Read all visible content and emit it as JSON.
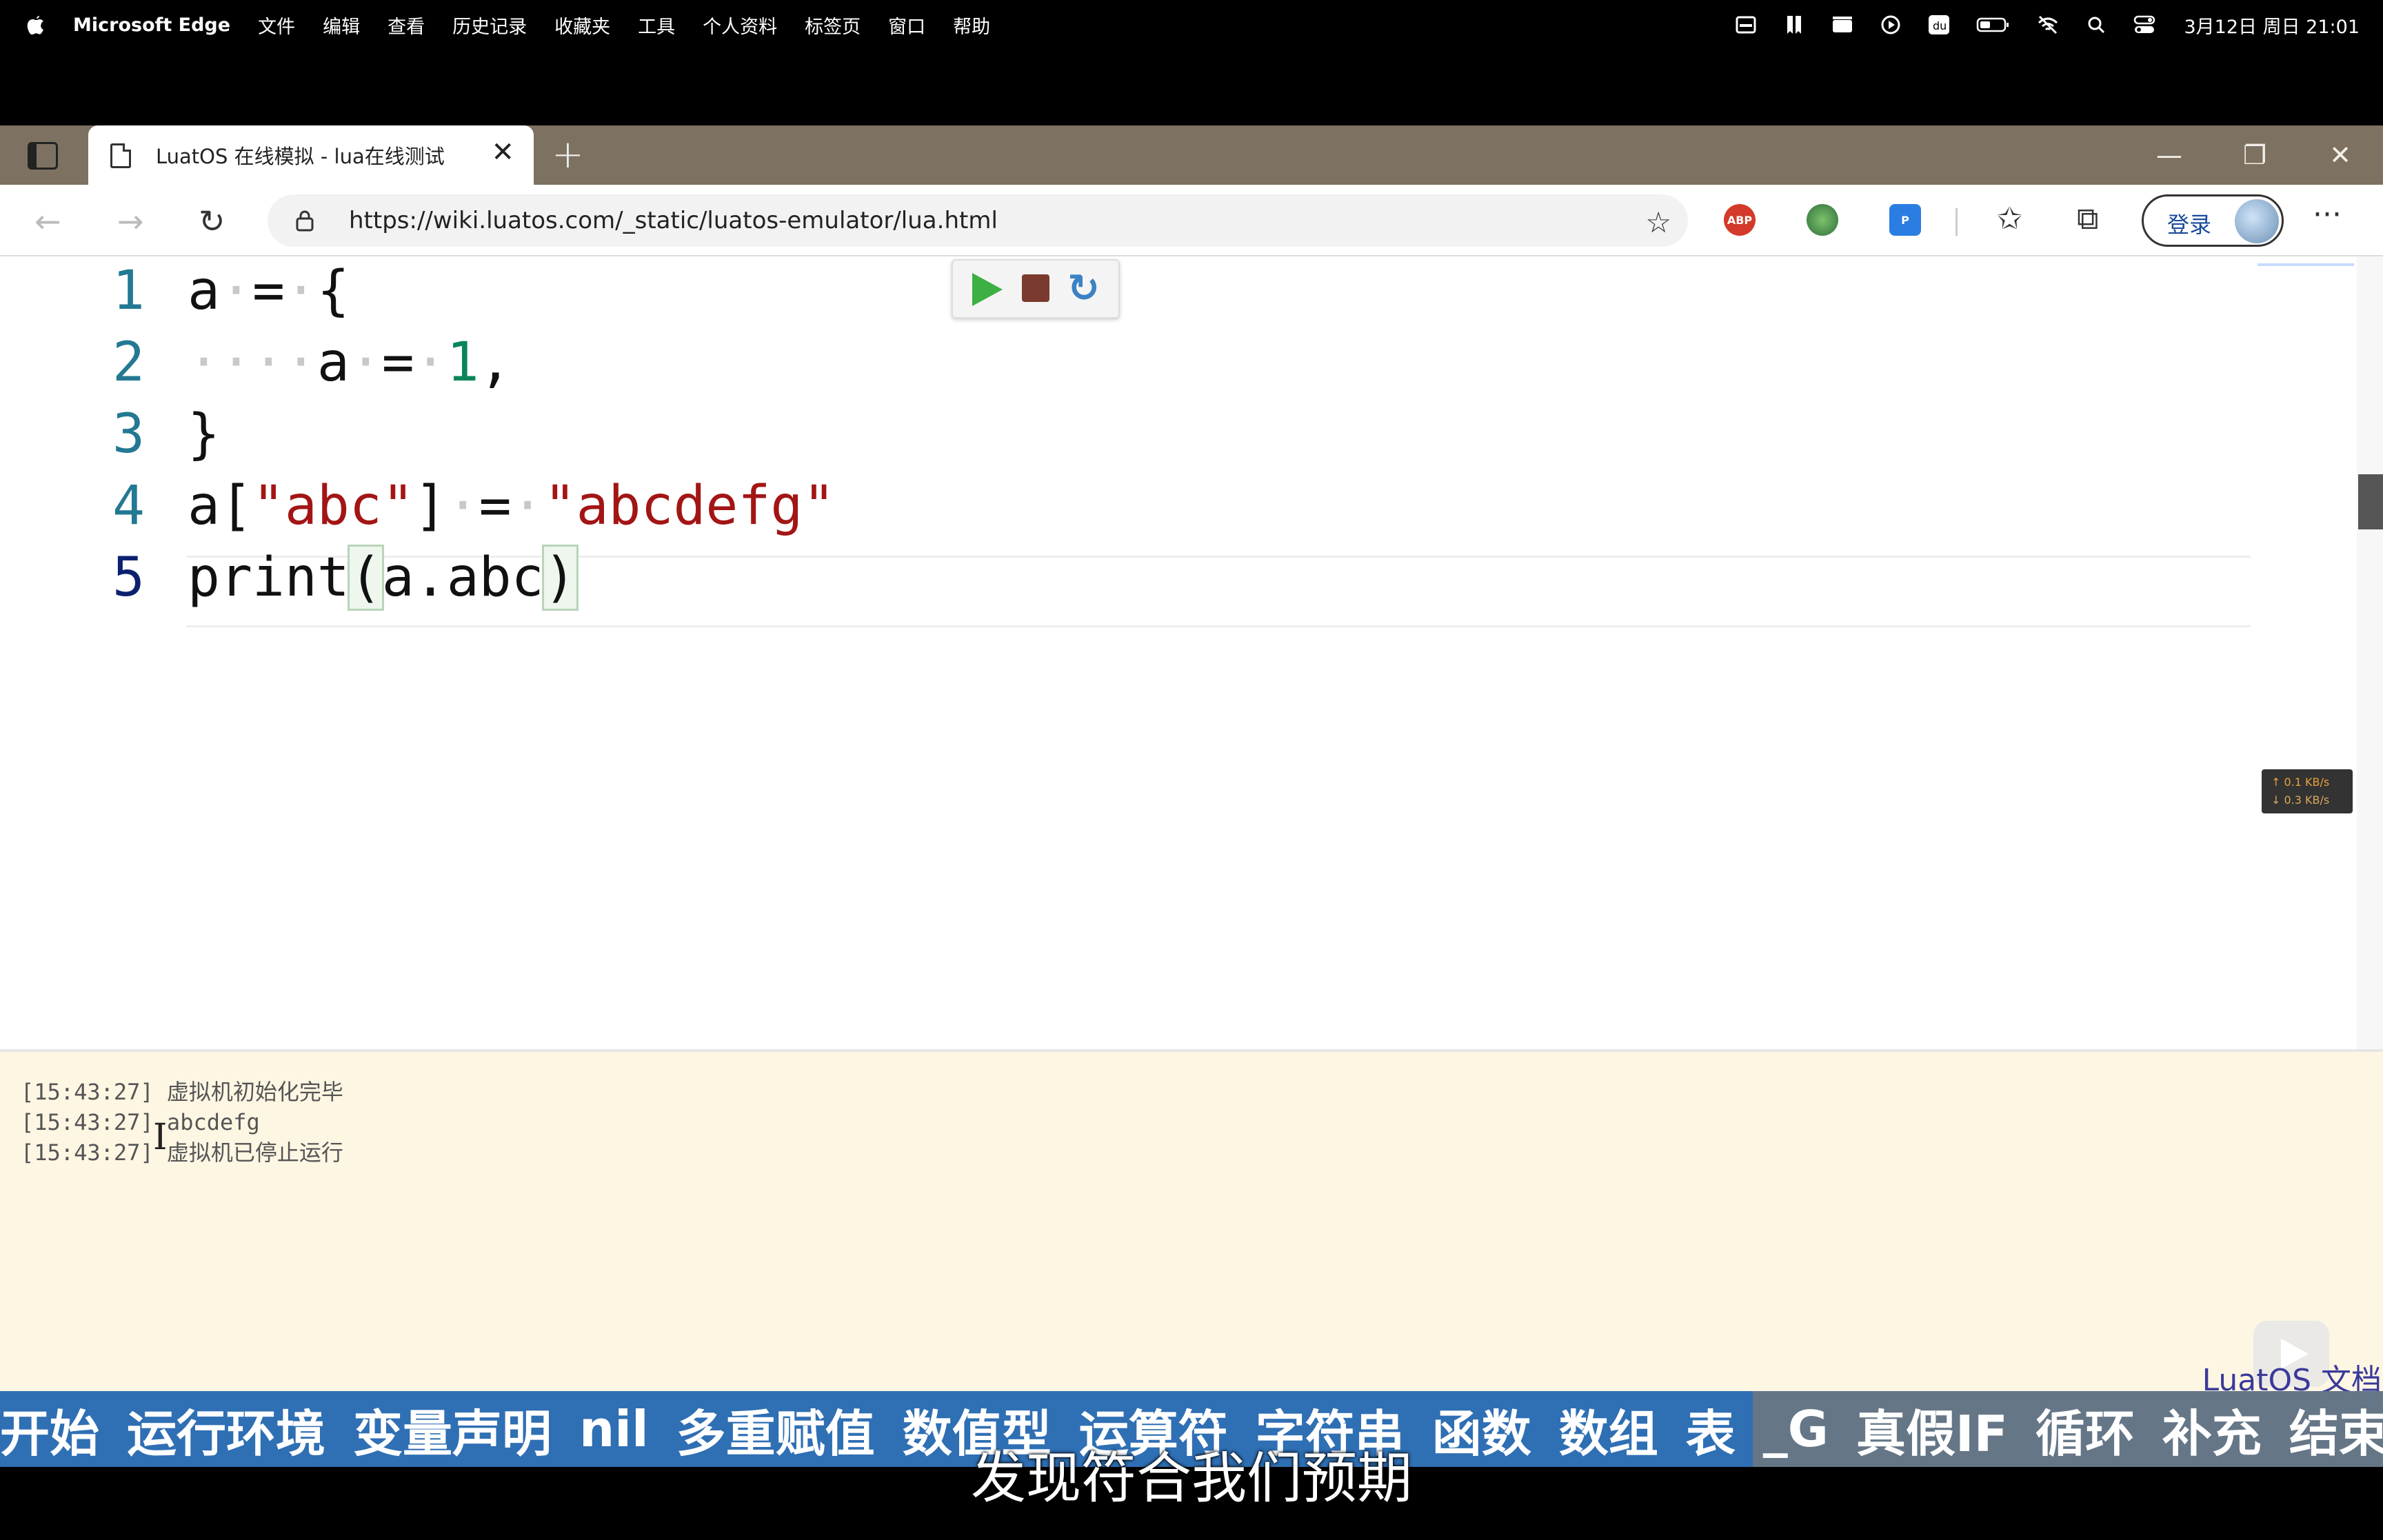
{
  "menubar": {
    "app_name": "Microsoft Edge",
    "menus": [
      "文件",
      "编辑",
      "查看",
      "历史记录",
      "收藏夹",
      "工具",
      "个人资料",
      "标签页",
      "窗口",
      "帮助"
    ],
    "clock": "3月12日 周日 21:01"
  },
  "browser": {
    "tab_title": "LuatOS 在线模拟 - lua在线测试",
    "url": "https://wiki.luatos.com/_static/luatos-emulator/lua.html",
    "login_label": "登录",
    "ext_abp": "ABP"
  },
  "editor": {
    "lines": [
      {
        "num": "1"
      },
      {
        "num": "2"
      },
      {
        "num": "3"
      },
      {
        "num": "4"
      },
      {
        "num": "5"
      }
    ],
    "net_up": "↑ 0.1 KB/s",
    "net_down": "↓ 0.3 KB/s"
  },
  "console": {
    "logs": [
      "[15:43:27] 虚拟机初始化完毕",
      "[15:43:27] abcdefg",
      "[15:43:27] 虚拟机已停止运行"
    ],
    "doc_link": "LuatOS 文档"
  },
  "chapters": [
    "开始",
    "运行环境",
    "变量声明",
    "nil",
    "多重赋值",
    "数值型",
    "运算符",
    "字符串",
    "函数",
    "数组",
    "表",
    "_G",
    "真假IF",
    "循环",
    "补充",
    "结束"
  ],
  "subtitle": "发现符合我们预期"
}
